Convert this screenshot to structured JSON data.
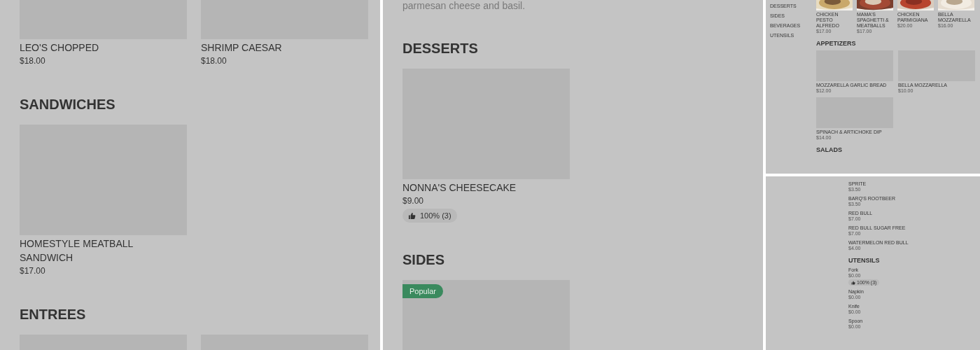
{
  "panels": [
    {
      "kind": "column",
      "blocks": [
        {
          "kind": "grid",
          "items": [
            {
              "kind": "placeholder",
              "name": "LEO'S CHOPPED",
              "price": "$18.00"
            },
            {
              "kind": "placeholder",
              "name": "SHRIMP CAESAR",
              "price": "$18.00"
            }
          ]
        },
        {
          "kind": "heading",
          "text": "SANDWICHES"
        },
        {
          "kind": "grid",
          "items": [
            {
              "kind": "placeholder",
              "name": "HOMESTYLE MEATBALL SANDWICH",
              "price": "$17.00"
            }
          ]
        },
        {
          "kind": "heading",
          "text": "ENTREES"
        },
        {
          "kind": "grid",
          "items": [
            {
              "kind": "placeholder"
            },
            {
              "kind": "placeholder"
            }
          ]
        }
      ]
    },
    {
      "kind": "column",
      "blocks": [
        {
          "kind": "description",
          "text": "parmesan cheese and basil."
        },
        {
          "kind": "heading",
          "text": "DESSERTS"
        },
        {
          "kind": "grid",
          "items": [
            {
              "kind": "placeholder",
              "name": "NONNA'S CHEESECAKE",
              "price": "$9.00",
              "rating": "100% (3)"
            }
          ]
        },
        {
          "kind": "heading",
          "text": "SIDES"
        },
        {
          "kind": "grid",
          "items": [
            {
              "kind": "placeholder",
              "badge": "Popular"
            }
          ]
        }
      ]
    },
    {
      "kind": "overview",
      "sidebar": [
        {
          "label": "DESSERTS"
        },
        {
          "label": "SIDES"
        },
        {
          "label": "BEVERAGES"
        },
        {
          "label": "UTENSILS"
        }
      ],
      "blocks": [
        {
          "kind": "grid",
          "items": [
            {
              "kind": "picture",
              "name": "CHICKEN PESTO ALFREDO",
              "price": "$17.00"
            },
            {
              "kind": "picture",
              "name": "MAMA'S SPAGHETTI & MEATBALLS",
              "price": "$17.00"
            },
            {
              "kind": "picture",
              "name": "CHICKEN PARMIGIANA",
              "price": "$20.00"
            },
            {
              "kind": "picture",
              "name": "BELLA MOZZARELLA",
              "price": "$16.00"
            }
          ]
        },
        {
          "kind": "heading",
          "text": "APPETIZERS"
        },
        {
          "kind": "grid",
          "items": [
            {
              "kind": "placeholder",
              "name": "MOZZARELLA GARLIC BREAD",
              "price": "$12.00"
            },
            {
              "kind": "placeholder",
              "name": "BELLA MOZZARELLA",
              "price": "$10.00"
            },
            {
              "kind": "placeholder",
              "name": "SPINACH & ARTICHOKE DIP",
              "price": "$14.00"
            }
          ]
        },
        {
          "kind": "heading",
          "text": "SALADS"
        }
      ]
    },
    {
      "kind": "overview",
      "blocks": [
        {
          "kind": "list",
          "items": [
            {
              "name": "SPRITE",
              "price": "$3.50"
            },
            {
              "name": "BARQ'S ROOTBEER",
              "price": "$3.50"
            },
            {
              "name": "RED BULL",
              "price": "$7.00"
            },
            {
              "name": "RED BULL SUGAR FREE",
              "price": "$7.00"
            },
            {
              "name": "WATERMELON RED BULL",
              "price": "$4.00"
            }
          ]
        },
        {
          "kind": "heading",
          "text": "UTENSILS"
        },
        {
          "kind": "list",
          "items": [
            {
              "name": "Fork",
              "price": "$0.00",
              "rating": "100% (3)"
            },
            {
              "name": "Napkin",
              "price": "$0.00"
            },
            {
              "name": "Knife",
              "price": "$0.00"
            },
            {
              "name": "Spoon",
              "price": "$0.00"
            }
          ]
        }
      ]
    }
  ]
}
